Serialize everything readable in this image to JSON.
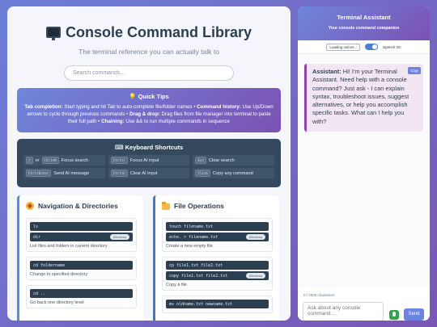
{
  "library": {
    "title": "Console Command Library",
    "subtitle": "The terminal reference you can actually talk to",
    "search_placeholder": "Search commands...",
    "tips": {
      "heading": "💡 Quick Tips",
      "t1_label": "Tab completion:",
      "t1_text": " Start typing and hit Tab to auto-complete file/folder names • ",
      "t2_label": "Command history:",
      "t2_text": " Use Up/Down arrows to cycle through previous commands • ",
      "t3_label": "Drag & drop:",
      "t3_text": " Drag files from file manager into terminal to paste their full path • ",
      "t4_label": "Chaining:",
      "t4_text": " Use && to run multiple commands in sequence"
    },
    "shortcuts": {
      "heading": "⌨ Keyboard Shortcuts",
      "items": [
        {
          "key": "/",
          "or": "or",
          "key2": "Ctrl+K",
          "label": "Focus search"
        },
        {
          "key": "Ctrl+/",
          "label": "Focus AI input"
        },
        {
          "key": "Esc",
          "label": "Clear search"
        },
        {
          "key": "Ctrl+Enter",
          "label": "Send AI message"
        },
        {
          "key": "Ctrl+L",
          "label": "Clear AI input"
        },
        {
          "key": "Click",
          "label": "Copy any command"
        }
      ]
    },
    "categories": [
      {
        "title": "Navigation & Directories",
        "commands": [
          {
            "lines": [
              "ls",
              "dir"
            ],
            "badge": "Windows",
            "desc": "List files and folders in current directory"
          },
          {
            "lines": [
              "cd foldername"
            ],
            "desc": "Change to specified directory"
          },
          {
            "lines": [
              "cd .."
            ],
            "desc": "Go back one directory level"
          }
        ]
      },
      {
        "title": "File Operations",
        "commands": [
          {
            "lines": [
              "touch filename.txt",
              "echo. > filename.txt"
            ],
            "badge": "Windows",
            "desc": "Create a new empty file"
          },
          {
            "lines": [
              "cp file1.txt file2.txt",
              "copy file1.txt file2.txt"
            ],
            "badge": "Windows",
            "desc": "Copy a file"
          },
          {
            "lines": [
              "mv oldname.txt newname.txt"
            ],
            "desc": ""
          }
        ]
      }
    ]
  },
  "assistant": {
    "title": "Terminal Assistant",
    "subtitle": "Your console command companion",
    "voice_select": "Loading voices...",
    "speech_label": "Speech On",
    "message_sender": "Assistant:",
    "message_text": " Hi! I'm your Terminal Assistant. Need help with a console command? Just ask - I can explain syntax, troubleshoot issues, suggest alternatives, or help you accomplish specific tasks. What can I help you with?",
    "copy_label": "Copy",
    "char_count": "0 / 2500 characters",
    "input_placeholder": "Ask about any console command...",
    "send_label": "Send"
  },
  "colors": {
    "accent": "#6c84e0",
    "header_gradient_start": "#6f86dc",
    "header_gradient_end": "#7b52b3",
    "code_bg": "#2c3e50"
  }
}
